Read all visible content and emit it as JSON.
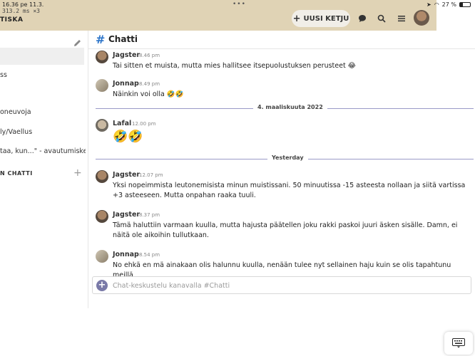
{
  "status_bar": {
    "time": "16.36",
    "date": "pe 11.3.",
    "dots": "•••",
    "battery_percent": "27 %",
    "battery_level": 0.27,
    "debug_text": "313.2 ms ×3"
  },
  "header": {
    "site_title": "TISKA",
    "new_topic_label": "UUSI KETJU",
    "icons": [
      "chat-icon",
      "search-icon",
      "menu-icon",
      "avatar"
    ]
  },
  "sidebar": {
    "items": [
      {
        "label": ""
      },
      {
        "label": "ss"
      },
      {
        "label": ""
      },
      {
        "label": "oneuvoja"
      },
      {
        "label": "ly/Vaellus"
      },
      {
        "label": "taa, kun...\" - avautumisketj..."
      }
    ],
    "section_header": "N CHATTI"
  },
  "channel": {
    "hash": "#",
    "name": "Chatti"
  },
  "messages": [
    {
      "author": "Jagster",
      "time": "8.46 pm",
      "text": "Tai sitten et muista, mutta mies hallitsee itsepuolustuksen perusteet 😂",
      "avatar": "jag"
    },
    {
      "author": "Jonnap",
      "time": "8.49 pm",
      "text": "Näinkin voi olla 🤣🤣",
      "avatar": "jon"
    },
    {
      "author": "Lafal",
      "time": "12.00 pm",
      "text": "🤣🤣",
      "avatar": "laf"
    },
    {
      "author": "Jagster",
      "time": "12.07 pm",
      "text": "Yksi nopeimmista leutonemisista minun muistissani. 50 minuutissa -15 asteesta nollaan ja siitä vartissa +3 asteeseen. Mutta onpahan raaka tuuli.",
      "avatar": "jag"
    },
    {
      "author": "Jagster",
      "time": "8.37 pm",
      "text": "Tämä haluttiin varmaan kuulla, mutta hajusta päätellen joku rakki paskoi juuri äsken sisälle. Damn, ei näitä ole aikoihin tullutkaan.",
      "avatar": "jag"
    },
    {
      "author": "Jonnap",
      "time": "8.54 pm",
      "text": "No ehkä en mä ainakaan olis halunnu kuulla, nenään tulee nyt sellainen haju kuin se olis tapahtunu meillä",
      "avatar": "jon"
    }
  ],
  "dividers": [
    {
      "label": "4. maaliskuuta 2022"
    },
    {
      "label": "Yesterday"
    }
  ],
  "composer": {
    "placeholder": "Chat-keskustelu kanavalla #Chatti",
    "value": ""
  },
  "colors": {
    "header_bg": "#e0d3b5",
    "accent_blue": "#2b74c9",
    "divider_line": "#9a9ac8",
    "composer_plus": "#7a7aa8"
  }
}
